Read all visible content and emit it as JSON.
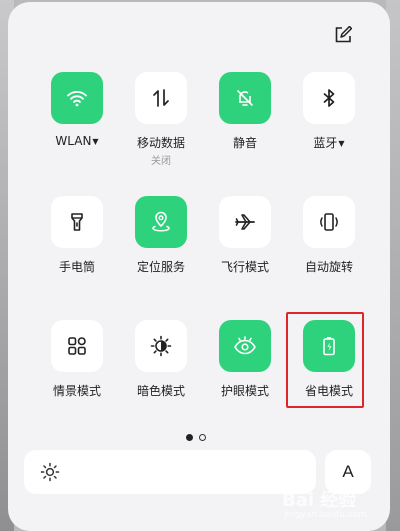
{
  "colors": {
    "accent_on": "#2fd27c",
    "tile_off": "#ffffff",
    "highlight": "#e0252a"
  },
  "edit_icon": "edit-icon",
  "tiles": [
    {
      "label": "WLAN",
      "dropdown": true,
      "state": "on",
      "icon": "wifi-icon"
    },
    {
      "label": "移动数据",
      "sub": "关闭",
      "state": "off",
      "icon": "mobile-data-icon"
    },
    {
      "label": "静音",
      "state": "on",
      "icon": "bell-off-icon"
    },
    {
      "label": "蓝牙",
      "dropdown": true,
      "state": "off",
      "icon": "bluetooth-icon"
    },
    {
      "label": "手电筒",
      "state": "off",
      "icon": "flashlight-icon"
    },
    {
      "label": "定位服务",
      "state": "on",
      "icon": "location-icon"
    },
    {
      "label": "飞行模式",
      "state": "off",
      "icon": "airplane-icon"
    },
    {
      "label": "自动旋转",
      "state": "off",
      "icon": "auto-rotate-icon"
    },
    {
      "label": "情景模式",
      "state": "off",
      "icon": "grid-icon"
    },
    {
      "label": "暗色模式",
      "state": "off",
      "icon": "dark-mode-icon"
    },
    {
      "label": "护眼模式",
      "state": "on",
      "icon": "eye-icon"
    },
    {
      "label": "省电模式",
      "state": "on",
      "icon": "battery-saver-icon",
      "highlighted": true
    }
  ],
  "pager": {
    "pages": 2,
    "current": 1
  },
  "brightness_icon": "sun-icon",
  "text_size_button": "A",
  "watermark": {
    "main": "Bai 经验",
    "sub": "jingyan.baidu.com"
  }
}
